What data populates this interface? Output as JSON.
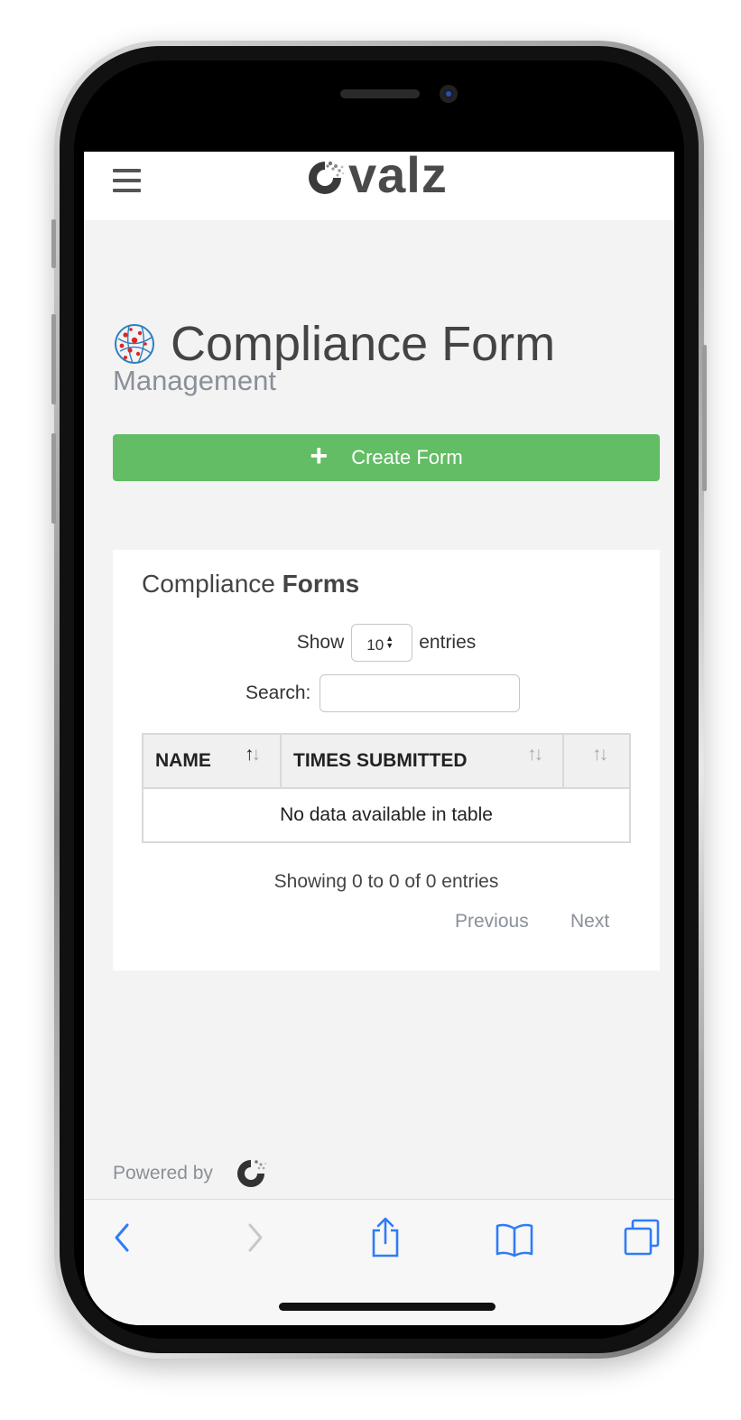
{
  "header": {
    "logo_text": "valz"
  },
  "page": {
    "title": "Compliance Form",
    "subtitle": "Management"
  },
  "create_button": {
    "icon": "+",
    "label": "Create Form"
  },
  "card": {
    "title_light": "Compliance ",
    "title_bold": "Forms",
    "show_label": "Show",
    "entries_value": "10",
    "entries_label": "entries",
    "search_label": "Search:",
    "search_value": "",
    "table": {
      "columns": [
        "NAME",
        "TIMES SUBMITTED",
        ""
      ],
      "empty_text": "No data available in table"
    },
    "info": "Showing 0 to 0 of 0 entries",
    "previous": "Previous",
    "next": "Next"
  },
  "footer": {
    "powered_by": "Powered by"
  },
  "browser_toolbar": {
    "items": [
      "back-icon",
      "forward-icon",
      "share-icon",
      "bookmarks-icon",
      "tabs-icon"
    ]
  },
  "colors": {
    "accent_green": "#62bd64",
    "text_muted": "#8a9099",
    "ios_blue": "#2f7cf6"
  }
}
